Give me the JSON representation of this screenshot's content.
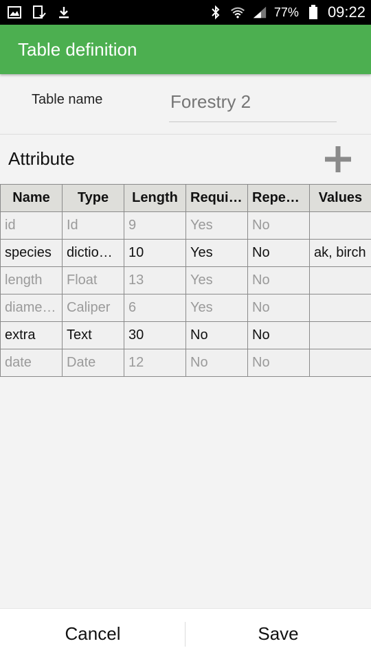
{
  "status_bar": {
    "left_icons": [
      "gallery-icon",
      "tablet-check-icon",
      "download-icon"
    ],
    "right_icons": [
      "bluetooth-icon",
      "wifi-icon",
      "signal-icon",
      "battery-icon"
    ],
    "battery": "77%",
    "time": "09:22"
  },
  "app_bar": {
    "title": "Table definition"
  },
  "table_name": {
    "label": "Table name",
    "placeholder": "Forestry 2"
  },
  "attributes": {
    "title": "Attribute",
    "add_icon": "plus-icon",
    "columns": [
      "Name",
      "Type",
      "Length",
      "Requir…",
      "Repea…",
      "Values"
    ],
    "rows": [
      {
        "cells": [
          "id",
          "Id",
          "9",
          "Yes",
          "No",
          ""
        ],
        "dim": true
      },
      {
        "cells": [
          "species",
          "diction…",
          "10",
          "Yes",
          "No",
          "ak, birch"
        ],
        "dim": false
      },
      {
        "cells": [
          "length",
          "Float",
          "13",
          "Yes",
          "No",
          ""
        ],
        "dim": true
      },
      {
        "cells": [
          "diamet…",
          "Caliper",
          "6",
          "Yes",
          "No",
          ""
        ],
        "dim": true
      },
      {
        "cells": [
          "extra",
          "Text",
          "30",
          "No",
          "No",
          ""
        ],
        "dim": false
      },
      {
        "cells": [
          "date",
          "Date",
          "12",
          "No",
          "No",
          ""
        ],
        "dim": true
      }
    ]
  },
  "bottom_bar": {
    "cancel_label": "Cancel",
    "save_label": "Save"
  }
}
